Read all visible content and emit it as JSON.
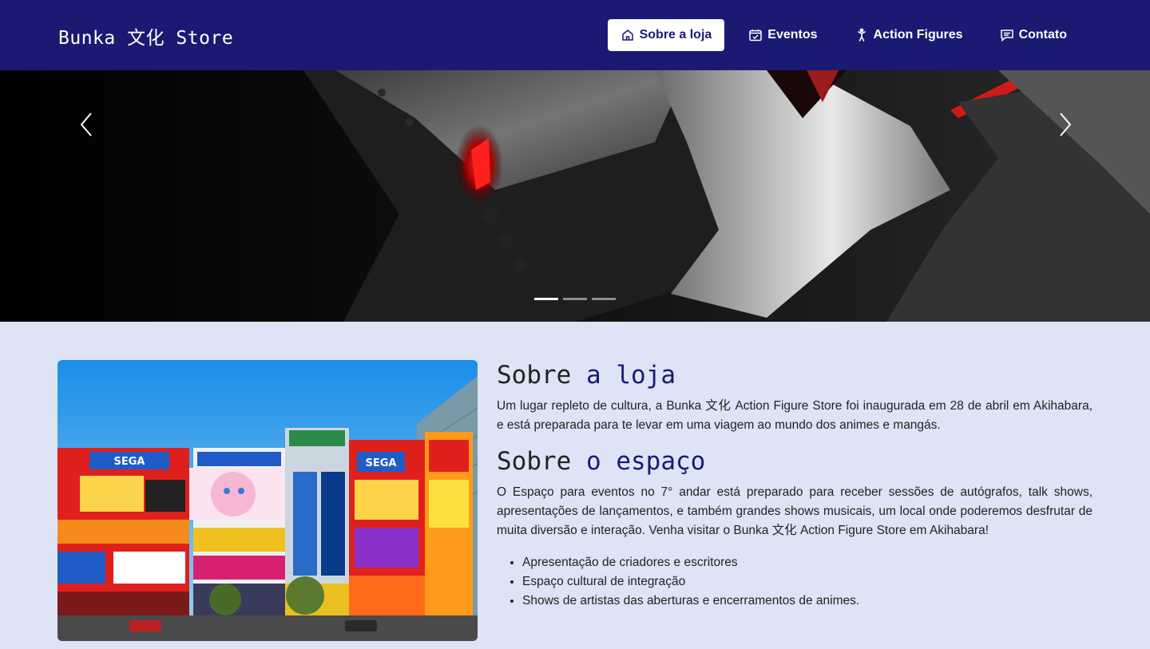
{
  "navbar": {
    "brand": "Bunka 文化 Store",
    "items": [
      {
        "label": "Sobre a loja",
        "icon": "home-icon",
        "active": true
      },
      {
        "label": "Eventos",
        "icon": "calendar-check-icon",
        "active": false
      },
      {
        "label": "Action Figures",
        "icon": "person-icon",
        "active": false
      },
      {
        "label": "Contato",
        "icon": "chat-icon",
        "active": false
      }
    ],
    "colors": {
      "background": "#1a1a73",
      "active_bg": "#ffffff"
    }
  },
  "carousel": {
    "slides_count": 3,
    "active_index": 0,
    "prev_icon": "chevron-left-icon",
    "next_icon": "chevron-right-icon"
  },
  "about_store": {
    "title_plain": "Sobre",
    "title_accent": "a loja",
    "text": "Um lugar repleto de cultura, a Bunka 文化  Action Figure Store foi inaugurada em 28 de abril em Akihabara, e está preparada para te levar em uma viagem ao mundo dos animes e mangás."
  },
  "about_space": {
    "title_plain": "Sobre",
    "title_accent": "o espaço",
    "text": "O Espaço para eventos no 7° andar está preparado para receber sessões de autógrafos, talk shows, apresentações de lançamentos, e também grandes shows musicais, um local onde poderemos desfrutar de muita diversão e interação. Venha visitar o Bunka 文化 Action Figure Store em Akihabara!",
    "features": [
      "Apresentação de criadores e escritores",
      "Espaço cultural de integração",
      "Shows de artistas das aberturas e encerramentos de animes."
    ]
  },
  "colors": {
    "page_bg": "#dce4f5",
    "accent": "#1a1a73"
  }
}
